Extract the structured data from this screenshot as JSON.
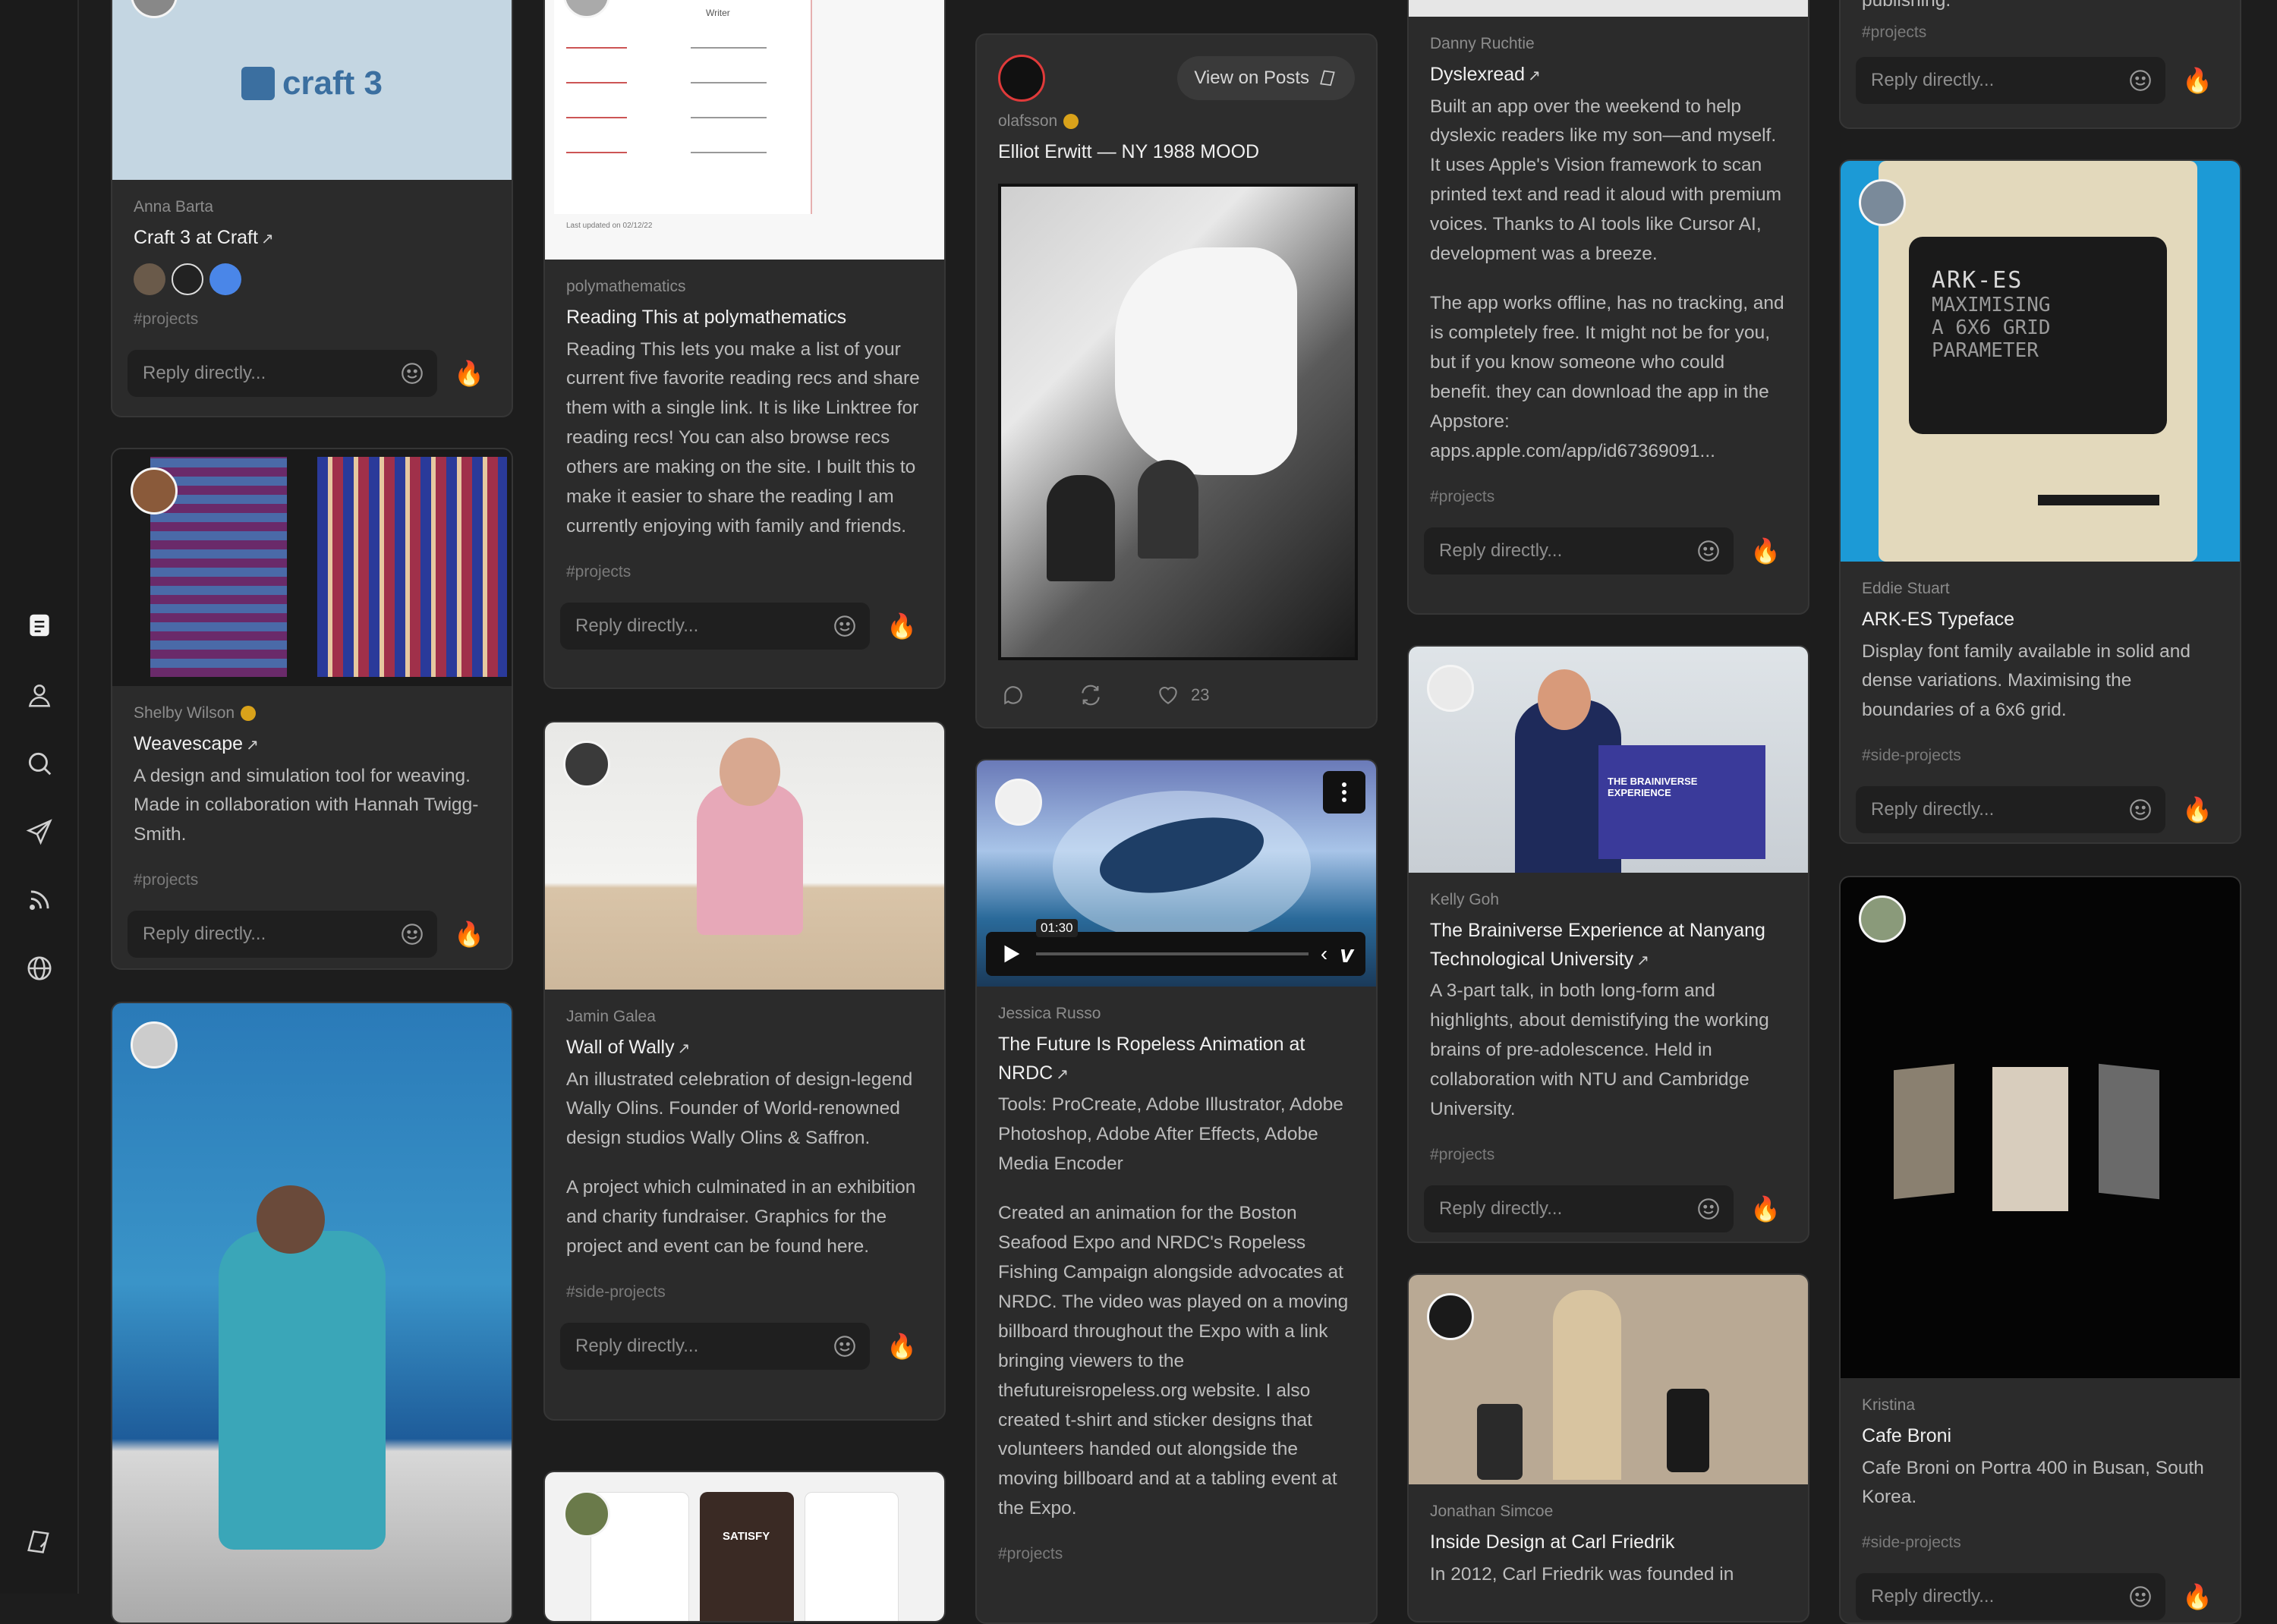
{
  "nav": {
    "items": [
      "notes-icon",
      "profile-icon",
      "search-icon",
      "send-icon",
      "rss-icon",
      "globe-icon"
    ],
    "bottom": "posts-icon"
  },
  "reply_placeholder": "Reply directly...",
  "col1": [
    {
      "author": "Anna Barta",
      "title": "Craft 3 at Craft",
      "tag": "#projects",
      "logo": "craft 3"
    },
    {
      "author": "Shelby Wilson",
      "title": "Weavescape",
      "desc": "A design and simulation tool for weaving. Made in collaboration with Hannah Twigg-Smith.",
      "tag": "#projects"
    }
  ],
  "col2": [
    {
      "author": "polymathematics",
      "title": "Reading This at polymathematics",
      "desc": "Reading This lets you make a list of your current five favorite reading recs and share them with a single link. It is like Linktree for reading recs! You can also browse recs others are making on the site. I built this to make it easier to share the reading I am currently enjoying with family and friends.",
      "tag": "#projects",
      "doc_header": "Writer",
      "doc_footer": "Last updated on 02/12/22"
    },
    {
      "author": "Jamin Galea",
      "title": "Wall of Wally",
      "desc1": "An illustrated celebration of design-legend Wally Olins. Founder of World-renowned design studios Wally Olins & Saffron.",
      "desc2": "A project which culminated in an exhibition and charity fundraiser. Graphics for the project and event can be found here.",
      "tag": "#side-projects"
    },
    {
      "app_label": "SATISFY"
    }
  ],
  "col3": [
    {
      "pill": "View on Posts",
      "author": "olafsson",
      "title": "Elliot Erwitt — NY 1988 MOOD",
      "likes": "23"
    },
    {
      "time": "01:30",
      "author": "Jessica Russo",
      "title": "The Future Is Ropeless Animation at NRDC",
      "desc1": "Tools: ProCreate, Adobe Illustrator, Adobe Photoshop, Adobe After Effects, Adobe Media Encoder",
      "desc2": "Created an animation for the Boston Seafood Expo and NRDC's Ropeless Fishing Campaign alongside advocates at NRDC. The video was played on a moving billboard throughout the Expo with a link bringing viewers to the thefutureisropeless.org website. I also created t-shirt and sticker designs that volunteers handed out alongside the moving billboard and at a tabling event at the Expo.",
      "tag": "#projects"
    }
  ],
  "col4": [
    {
      "author": "Danny Ruchtie",
      "title": "Dyslexread",
      "desc1": "Built an app over the weekend to help dyslexic readers like my son—and myself. It uses Apple's Vision framework to scan printed text and read it aloud with premium voices. Thanks to AI tools like Cursor AI, development was a breeze.",
      "desc2": "The app works offline, has no tracking, and is completely free. It might not be for you, but if you know someone who could benefit. they can download the app in the Appstore: apps.apple.com/app/id67369091...",
      "tag": "#projects"
    },
    {
      "author": "Kelly Goh",
      "title": "The Brainiverse Experience at Nanyang Technological University",
      "desc": "A 3-part talk, in both long-form and highlights, about demistifying the working brains of pre-adolescence. Held in collaboration with NTU and Cambridge University.",
      "tag": "#projects",
      "podium": "THE BRAINIVERSE EXPERIENCE"
    },
    {
      "author": "Jonathan Simcoe",
      "title": "Inside Design at Carl Friedrik",
      "desc": "In 2012, Carl Friedrik was founded in"
    }
  ],
  "col5": [
    {
      "text_top": "publishing.",
      "tag": "#projects"
    },
    {
      "author": "Eddie Stuart",
      "title": "ARK-ES Typeface",
      "desc": "Display font family available in solid and dense variations. Maximising the boundaries of a 6x6 grid.",
      "tag": "#side-projects",
      "screen": [
        "ARK-ES",
        "MAXIMISING",
        "A 6X6 GRID",
        "PARAMETER"
      ]
    },
    {
      "author": "Kristina",
      "title": "Cafe Broni",
      "desc": "Cafe Broni on Portra 400 in Busan, South Korea.",
      "tag": "#side-projects"
    }
  ],
  "colors": {
    "bg": "#1d1d1d",
    "card": "#2b2b2b",
    "reply": "#1f1f1f",
    "verified": "#d9a21a"
  }
}
